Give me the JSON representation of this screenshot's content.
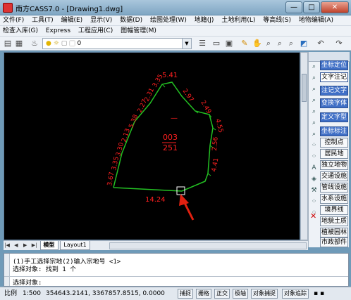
{
  "window": {
    "title": "南方CASS7.0 - [Drawing1.dwg]",
    "minimize": "—",
    "maximize": "□",
    "close": "✕"
  },
  "menu1": [
    "文件(F)",
    "工具(T)",
    "编辑(E)",
    "显示(V)",
    "数据(D)",
    "绘图处理(W)",
    "地籍(J)",
    "土地利用(L)",
    "等高线(S)",
    "地物编辑(A)"
  ],
  "menu2": [
    "检查入库(G)",
    "Express",
    "工程应用(C)",
    "图幅管理(M)"
  ],
  "toolbar": {
    "layer_value": "0"
  },
  "canvas": {
    "parcel_labels": [
      "003",
      "251"
    ],
    "dimension_labels": [
      "5.41",
      "2.97",
      "2.49",
      "4.55",
      "4.41",
      "2.56",
      "14.24",
      "3.35",
      "2.31",
      "2.27",
      "5.38",
      "2.13",
      "3.30",
      "3.35",
      "3.67"
    ],
    "center_dash": "—",
    "colors": {
      "boundary": "#23c023",
      "text": "#ff2020",
      "arrow": "#e02010",
      "background": "#000000"
    }
  },
  "right_panel": {
    "title": "坐标定位",
    "buttons": [
      {
        "label": "文字注记",
        "style": "sel"
      },
      {
        "label": "注记文字",
        "style": "blue"
      },
      {
        "label": "变换字体",
        "style": "blue"
      },
      {
        "label": "定义字型",
        "style": "blue"
      },
      {
        "label": "坐标标注",
        "style": "blue"
      },
      {
        "label": "控制点",
        "style": "normal"
      },
      {
        "label": "居民地",
        "style": "normal"
      },
      {
        "label": "独立地物",
        "style": "normal"
      },
      {
        "label": "交通设施",
        "style": "normal"
      },
      {
        "label": "管线设施",
        "style": "normal"
      },
      {
        "label": "水系设施",
        "style": "normal"
      },
      {
        "label": "境界线",
        "style": "normal"
      },
      {
        "label": "地貌土质",
        "style": "normal"
      },
      {
        "label": "植被园林",
        "style": "normal"
      },
      {
        "label": "市政部件",
        "style": "normal"
      }
    ]
  },
  "tabs": {
    "model": "模型",
    "layout1": "Layout1"
  },
  "command": {
    "line1": "(1)手工选择宗地(2)输入宗地号 <1>",
    "line2": "选择对象: 找到 1 个",
    "prompt": "选择对象:"
  },
  "status": {
    "scale_label": "比例",
    "scale_value": "1:500",
    "coords": "354643.2141, 3367857.8515, 0.0000",
    "toggles": [
      "捕捉",
      "栅格",
      "正交",
      "极轴",
      "对象捕捉",
      "对象追踪"
    ]
  }
}
